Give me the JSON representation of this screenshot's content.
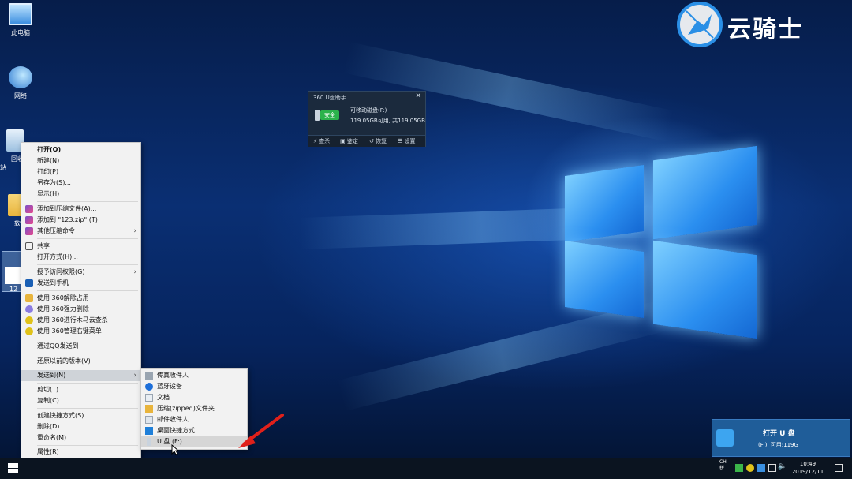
{
  "desktop": {
    "icons": [
      {
        "label": "此电脑"
      },
      {
        "label": "网络"
      },
      {
        "label": "回收站"
      },
      {
        "label": "软"
      },
      {
        "label": "12"
      }
    ]
  },
  "context_menu": {
    "items": [
      {
        "label": "打开(O)"
      },
      {
        "label": "新建(N)"
      },
      {
        "label": "打印(P)"
      },
      {
        "label": "另存为(S)..."
      },
      {
        "label": "显示(H)"
      },
      {
        "label": "添加到压缩文件(A)..."
      },
      {
        "label": "添加到 \"123.zip\" (T)"
      },
      {
        "label": "其他压缩命令"
      },
      {
        "label": "共享"
      },
      {
        "label": "打开方式(H)..."
      },
      {
        "label": "授予访问权限(G)"
      },
      {
        "label": "发送到手机"
      },
      {
        "label": "使用 360解除占用"
      },
      {
        "label": "使用 360强力删除"
      },
      {
        "label": "使用 360进行木马云查杀"
      },
      {
        "label": "使用 360管理右键菜单"
      },
      {
        "label": "通过QQ发送到"
      },
      {
        "label": "还原以前的版本(V)"
      },
      {
        "label": "发送到(N)"
      },
      {
        "label": "剪切(T)"
      },
      {
        "label": "复制(C)"
      },
      {
        "label": "创建快捷方式(S)"
      },
      {
        "label": "删除(D)"
      },
      {
        "label": "重命名(M)"
      },
      {
        "label": "属性(R)"
      }
    ]
  },
  "send_to_menu": {
    "items": [
      {
        "label": "传真收件人"
      },
      {
        "label": "蓝牙设备"
      },
      {
        "label": "文档"
      },
      {
        "label": "压缩(zipped)文件夹"
      },
      {
        "label": "邮件收件人"
      },
      {
        "label": "桌面快捷方式"
      },
      {
        "label": "U 盘 (F:)"
      }
    ]
  },
  "usb_popup": {
    "title": "360 U盘助手",
    "close": "✕",
    "safe_label": "安全",
    "disk_name": "可移动磁盘(F:)",
    "capacity": "119.05GB可用, 共119.05GB",
    "actions": [
      "查杀",
      "鉴定",
      "恢复",
      "设置"
    ]
  },
  "logo": {
    "text": "云骑士"
  },
  "toast": {
    "title": "打开 U 盘",
    "drive": "(F:)",
    "available": "可用:119G"
  },
  "taskbar": {
    "lang_top": "CH",
    "lang_bottom": "拼",
    "time": "10:49",
    "date": "2019/12/11"
  },
  "colors": {
    "menu_bg": "#f2f2f2",
    "menu_highlight": "#cfd3d8",
    "popup_bg": "#1b2a3d",
    "safe_green": "#2bb24c",
    "toast_bg": "#1f5d99",
    "taskbar_bg": "#0b1420",
    "accent_blue": "#2a8fe6"
  }
}
